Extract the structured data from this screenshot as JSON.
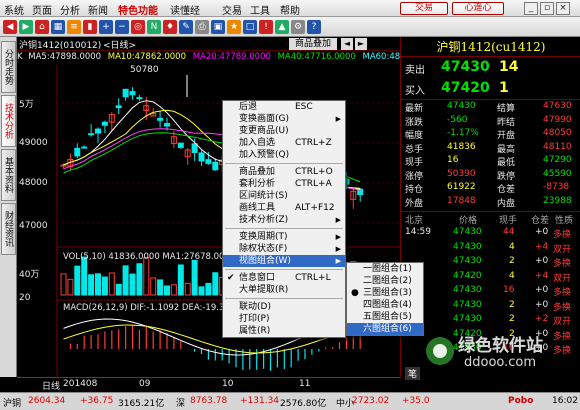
{
  "menu": {
    "items": [
      "系统",
      "页面",
      "分析",
      "新闻",
      "特色功能",
      "读懂经 ",
      "交易",
      "工具",
      "帮助"
    ],
    "trade_btn": "交易",
    "xinkuai_btn": "心遥心"
  },
  "tabs": {
    "left": [
      "分时走势",
      "技术分析",
      "基本资料",
      "财经资讯"
    ]
  },
  "chart_header": {
    "instrument": "沪铜1412(010012)",
    "period": "<日线>",
    "btn_overlay": "商品叠加"
  },
  "ma_line": {
    "ma5": "MA5:47898.0000",
    "ma10": "MA10:47862.0000",
    "ma20": "MA20:47789.0000",
    "ma40": "MA40:47716.0000",
    "ma60": "MA60:48"
  },
  "peak_label": "50780",
  "y_axis": {
    "unit": "5万",
    "ticks": [
      "49000",
      "48000",
      "47000"
    ]
  },
  "vol_panel": {
    "label": "VOL(5,10) 41836.0000 MA1:27678.00",
    "y1": "40万",
    "y2": "20"
  },
  "macd_panel": {
    "label": "MACD(26,12,9) DIF:-1.1092 DEA:-19.36"
  },
  "x_axis": {
    "ticks": [
      "日线",
      "201408",
      "09",
      "10",
      "11"
    ]
  },
  "right_panel": {
    "title": "沪铜1412(cu1412)",
    "sell_label": "卖出",
    "sell_price": "47430",
    "sell_vol": "14",
    "buy_label": "买入",
    "buy_price": "47420",
    "buy_vol": "1",
    "rows": [
      {
        "l1": "最新",
        "v1": "47430",
        "l2": "结算",
        "v2": "47630"
      },
      {
        "l1": "涨跌",
        "v1": "-560",
        "l2": "昨结",
        "v2": "47990"
      },
      {
        "l1": "幅度",
        "v1": "-1.17%",
        "l2": "开盘",
        "v2": "48050"
      },
      {
        "l1": "总手",
        "v1": "41836",
        "l2": "最高",
        "v2": "48110"
      },
      {
        "l1": "现手",
        "v1": "16",
        "l2": "最低",
        "v2": "47290"
      },
      {
        "l1": "涨停",
        "v1": "50390",
        "l2": "跌停",
        "v2": "45590"
      },
      {
        "l1": "持仓",
        "v1": "61922",
        "l2": "仓差",
        "v2": "-8738"
      },
      {
        "l1": "外盘",
        "v1": "17848",
        "l2": "内盘",
        "v2": "23988"
      }
    ],
    "tick_header": [
      "北京",
      "价格",
      "现手",
      "仓差",
      "性质"
    ],
    "ticks": [
      {
        "t": "14:59",
        "p": "47430",
        "v": "44",
        "d": "+0",
        "n": "多换"
      },
      {
        "t": "",
        "p": "47430",
        "v": "4",
        "d": "+4",
        "n": "双开"
      },
      {
        "t": "",
        "p": "47430",
        "v": "2",
        "d": "+0",
        "n": "多换"
      },
      {
        "t": "",
        "p": "47420",
        "v": "4",
        "d": "+4",
        "n": "双开"
      },
      {
        "t": "",
        "p": "47430",
        "v": "16",
        "d": "+0",
        "n": "多换"
      },
      {
        "t": "",
        "p": "47430",
        "v": "2",
        "d": "+0",
        "n": "多换"
      },
      {
        "t": "",
        "p": "47430",
        "v": "2",
        "d": "+2",
        "n": "双开"
      },
      {
        "t": "",
        "p": "47420",
        "v": "2",
        "d": "+0",
        "n": "多换"
      },
      {
        "t": "",
        "p": "47430",
        "v": "16",
        "d": "+0",
        "n": "多换"
      }
    ],
    "side_tab": "笔"
  },
  "context_menu": {
    "items": [
      {
        "label": "后退",
        "sc": "ESC"
      },
      {
        "label": "变换画面(G)",
        "sc": "",
        "arrow": true
      },
      {
        "label": "变更商品(U)",
        "sc": ""
      },
      {
        "label": "加入自选",
        "sc": "CTRL+Z"
      },
      {
        "label": "加入预警(Q)",
        "sc": ""
      },
      {
        "sep": true
      },
      {
        "label": "商品叠加",
        "sc": "CTRL+O"
      },
      {
        "label": "套利分析",
        "sc": "CTRL+A"
      },
      {
        "label": "区间统计(S)",
        "sc": ""
      },
      {
        "label": "画线工具",
        "sc": "ALT+F12"
      },
      {
        "label": "技术分析(Z)",
        "sc": "",
        "arrow": true
      },
      {
        "sep": true
      },
      {
        "label": "变换周期(T)",
        "sc": "",
        "arrow": true
      },
      {
        "label": "除权状态(F)",
        "sc": "",
        "arrow": true
      },
      {
        "label": "视图组合(W)",
        "sc": "",
        "arrow": true,
        "sel": true
      },
      {
        "sep": true
      },
      {
        "label": "信息窗口",
        "sc": "CTRL+L",
        "check": true
      },
      {
        "label": "大单提取(R)",
        "sc": ""
      },
      {
        "sep": true
      },
      {
        "label": "联动(D)",
        "sc": ""
      },
      {
        "label": "打印(P)",
        "sc": ""
      },
      {
        "label": "属性(R)",
        "sc": ""
      }
    ]
  },
  "submenu": {
    "items": [
      {
        "label": "一图组合(1)"
      },
      {
        "label": "二图组合(2)"
      },
      {
        "label": "三图组合(3)",
        "dot": true
      },
      {
        "label": "四图组合(4)"
      },
      {
        "label": "五图组合(5)"
      },
      {
        "label": "六图组合(6)",
        "sel": true
      }
    ]
  },
  "status": {
    "s1": "沪铜",
    "v1": "2604.34",
    "c1": "+36.75",
    "x1": "3165.21亿",
    "s2": "深",
    "v2": "8763.78",
    "c2": "+131.34",
    "x2": "2576.80亿",
    "s3": "中小",
    "v3": "2723.02",
    "c3": "+35.0",
    "x3": "",
    "brand": "Pobo",
    "time": "16:02"
  },
  "watermark": {
    "title": "绿色软件站",
    "url": "ddooo.com"
  }
}
